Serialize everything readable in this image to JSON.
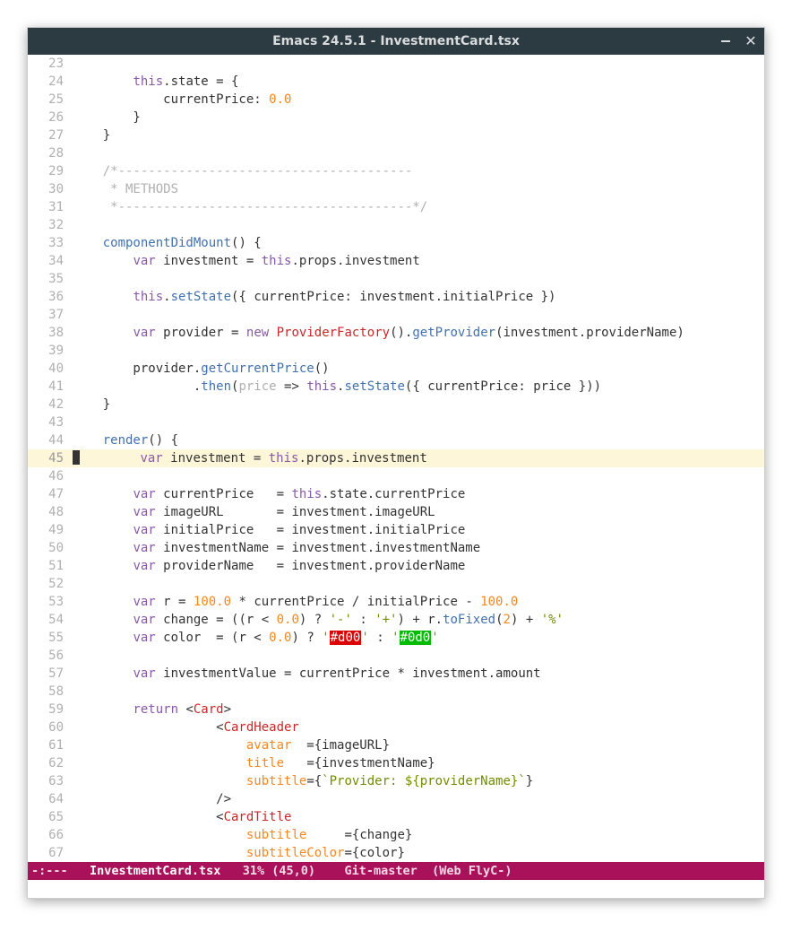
{
  "window": {
    "title": "Emacs 24.5.1 - InvestmentCard.tsx"
  },
  "modeline": {
    "left": "-:---",
    "filename": "InvestmentCard.tsx",
    "percent": "31% (45,0)",
    "vc": "Git-master",
    "modes": "(Web FlyC-)"
  },
  "cursor": {
    "line": 45,
    "col": 0
  },
  "lines": [
    {
      "n": 23,
      "raw": ""
    },
    {
      "n": 24,
      "tokens": [
        [
          "        ",
          ""
        ],
        [
          "this",
          "kw"
        ],
        [
          ".state = {",
          ""
        ]
      ]
    },
    {
      "n": 25,
      "tokens": [
        [
          "            currentPrice: ",
          ""
        ],
        [
          "0.0",
          "num"
        ]
      ]
    },
    {
      "n": 26,
      "tokens": [
        [
          "        }",
          ""
        ]
      ]
    },
    {
      "n": 27,
      "tokens": [
        [
          "    }",
          ""
        ]
      ]
    },
    {
      "n": 28,
      "raw": ""
    },
    {
      "n": 29,
      "tokens": [
        [
          "    ",
          ""
        ],
        [
          "/*---------------------------------------",
          "cm"
        ]
      ]
    },
    {
      "n": 30,
      "tokens": [
        [
          "    ",
          ""
        ],
        [
          " * METHODS",
          "cm"
        ]
      ]
    },
    {
      "n": 31,
      "tokens": [
        [
          "    ",
          ""
        ],
        [
          " *---------------------------------------*/",
          "cm"
        ]
      ]
    },
    {
      "n": 32,
      "raw": ""
    },
    {
      "n": 33,
      "tokens": [
        [
          "    ",
          ""
        ],
        [
          "componentDidMount",
          "fn"
        ],
        [
          "() {",
          ""
        ]
      ]
    },
    {
      "n": 34,
      "tokens": [
        [
          "        ",
          ""
        ],
        [
          "var",
          "kw"
        ],
        [
          " investment = ",
          ""
        ],
        [
          "this",
          "kw"
        ],
        [
          ".props.investment",
          ""
        ]
      ]
    },
    {
      "n": 35,
      "raw": ""
    },
    {
      "n": 36,
      "tokens": [
        [
          "        ",
          ""
        ],
        [
          "this",
          "kw"
        ],
        [
          ".",
          ""
        ],
        [
          "setState",
          "fn"
        ],
        [
          "({ currentPrice: investment.initialPrice })",
          ""
        ]
      ]
    },
    {
      "n": 37,
      "raw": ""
    },
    {
      "n": 38,
      "tokens": [
        [
          "        ",
          ""
        ],
        [
          "var",
          "kw"
        ],
        [
          " provider = ",
          ""
        ],
        [
          "new",
          "kw"
        ],
        [
          " ",
          ""
        ],
        [
          "ProviderFactory",
          "tag"
        ],
        [
          "().",
          ""
        ],
        [
          "getProvider",
          "fn"
        ],
        [
          "(investment.providerName)",
          ""
        ]
      ]
    },
    {
      "n": 39,
      "raw": ""
    },
    {
      "n": 40,
      "tokens": [
        [
          "        provider.",
          ""
        ],
        [
          "getCurrentPrice",
          "fn"
        ],
        [
          "()",
          ""
        ]
      ]
    },
    {
      "n": 41,
      "tokens": [
        [
          "                .",
          ""
        ],
        [
          "then",
          "fn"
        ],
        [
          "(",
          ""
        ],
        [
          "price",
          "cm"
        ],
        [
          " => ",
          ""
        ],
        [
          "this",
          "kw"
        ],
        [
          ".",
          ""
        ],
        [
          "setState",
          "fn"
        ],
        [
          "({ currentPrice: price }))",
          ""
        ]
      ]
    },
    {
      "n": 42,
      "tokens": [
        [
          "    }",
          ""
        ]
      ]
    },
    {
      "n": 43,
      "raw": ""
    },
    {
      "n": 44,
      "tokens": [
        [
          "    ",
          ""
        ],
        [
          "render",
          "fn"
        ],
        [
          "() ",
          ""
        ],
        [
          "{",
          "pn"
        ]
      ]
    },
    {
      "n": 45,
      "current": true,
      "tokens": [
        [
          "        ",
          ""
        ],
        [
          "var",
          "kw"
        ],
        [
          " investment = ",
          ""
        ],
        [
          "this",
          "kw"
        ],
        [
          ".props.investment",
          ""
        ]
      ]
    },
    {
      "n": 46,
      "raw": ""
    },
    {
      "n": 47,
      "tokens": [
        [
          "        ",
          ""
        ],
        [
          "var",
          "kw"
        ],
        [
          " currentPrice   = ",
          ""
        ],
        [
          "this",
          "kw"
        ],
        [
          ".state.currentPrice",
          ""
        ]
      ]
    },
    {
      "n": 48,
      "tokens": [
        [
          "        ",
          ""
        ],
        [
          "var",
          "kw"
        ],
        [
          " imageURL       = investment.imageURL",
          ""
        ]
      ]
    },
    {
      "n": 49,
      "tokens": [
        [
          "        ",
          ""
        ],
        [
          "var",
          "kw"
        ],
        [
          " initialPrice   = investment.initialPrice",
          ""
        ]
      ]
    },
    {
      "n": 50,
      "tokens": [
        [
          "        ",
          ""
        ],
        [
          "var",
          "kw"
        ],
        [
          " investmentName = investment.investmentName",
          ""
        ]
      ]
    },
    {
      "n": 51,
      "tokens": [
        [
          "        ",
          ""
        ],
        [
          "var",
          "kw"
        ],
        [
          " providerName   = investment.providerName",
          ""
        ]
      ]
    },
    {
      "n": 52,
      "raw": ""
    },
    {
      "n": 53,
      "tokens": [
        [
          "        ",
          ""
        ],
        [
          "var",
          "kw"
        ],
        [
          " r = ",
          ""
        ],
        [
          "100.0",
          "num"
        ],
        [
          " * currentPrice / initialPrice - ",
          ""
        ],
        [
          "100.0",
          "num"
        ]
      ]
    },
    {
      "n": 54,
      "tokens": [
        [
          "        ",
          ""
        ],
        [
          "var",
          "kw"
        ],
        [
          " change = ((r < ",
          ""
        ],
        [
          "0.0",
          "num"
        ],
        [
          ") ? ",
          ""
        ],
        [
          "'-'",
          "str"
        ],
        [
          " : ",
          ""
        ],
        [
          "'+'",
          "str"
        ],
        [
          ") + r.",
          ""
        ],
        [
          "toFixed",
          "fn"
        ],
        [
          "(",
          ""
        ],
        [
          "2",
          "num"
        ],
        [
          ") + ",
          ""
        ],
        [
          "'%'",
          "str"
        ]
      ]
    },
    {
      "n": 55,
      "tokens": [
        [
          "        ",
          ""
        ],
        [
          "var",
          "kw"
        ],
        [
          " color  = (r < ",
          ""
        ],
        [
          "0.0",
          "num"
        ],
        [
          ") ? ",
          ""
        ],
        [
          "'",
          "str"
        ],
        [
          "#d00",
          "hl-red"
        ],
        [
          "'",
          "str"
        ],
        [
          " : ",
          ""
        ],
        [
          "'",
          "str"
        ],
        [
          "#0d0",
          "hl-green"
        ],
        [
          "'",
          "str"
        ]
      ]
    },
    {
      "n": 56,
      "raw": ""
    },
    {
      "n": 57,
      "tokens": [
        [
          "        ",
          ""
        ],
        [
          "var",
          "kw"
        ],
        [
          " investmentValue = currentPrice * investment.amount",
          ""
        ]
      ]
    },
    {
      "n": 58,
      "raw": ""
    },
    {
      "n": 59,
      "tokens": [
        [
          "        ",
          ""
        ],
        [
          "return",
          "kw"
        ],
        [
          " <",
          ""
        ],
        [
          "Card",
          "tag"
        ],
        [
          ">",
          ""
        ]
      ]
    },
    {
      "n": 60,
      "tokens": [
        [
          "                   <",
          ""
        ],
        [
          "CardHeader",
          "tag"
        ]
      ]
    },
    {
      "n": 61,
      "tokens": [
        [
          "                       ",
          ""
        ],
        [
          "avatar",
          "attr"
        ],
        [
          "  ={imageURL}",
          ""
        ]
      ]
    },
    {
      "n": 62,
      "tokens": [
        [
          "                       ",
          ""
        ],
        [
          "title",
          "attr"
        ],
        [
          "   ={investmentName}",
          ""
        ]
      ]
    },
    {
      "n": 63,
      "tokens": [
        [
          "                       ",
          ""
        ],
        [
          "subtitle",
          "attr"
        ],
        [
          "={",
          ""
        ],
        [
          "`Provider: ${providerName}`",
          "str"
        ],
        [
          "}",
          ""
        ]
      ]
    },
    {
      "n": 64,
      "tokens": [
        [
          "                   />",
          ""
        ]
      ]
    },
    {
      "n": 65,
      "tokens": [
        [
          "                   <",
          ""
        ],
        [
          "CardTitle",
          "tag"
        ]
      ]
    },
    {
      "n": 66,
      "tokens": [
        [
          "                       ",
          ""
        ],
        [
          "subtitle",
          "attr"
        ],
        [
          "     ={change}",
          ""
        ]
      ]
    },
    {
      "n": 67,
      "tokens": [
        [
          "                       ",
          ""
        ],
        [
          "subtitleColor",
          "attr"
        ],
        [
          "={color}",
          ""
        ]
      ]
    }
  ]
}
